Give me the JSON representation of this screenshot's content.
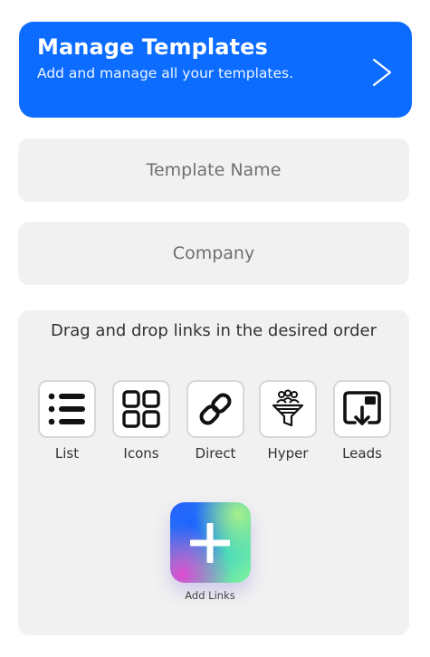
{
  "header": {
    "title": "Manage Templates",
    "subtitle": "Add and manage all your templates.",
    "arrow_icon": "chevron-right-icon",
    "background": "#0b6cff"
  },
  "fields": {
    "template_name": {
      "placeholder": "Template Name",
      "value": ""
    },
    "company": {
      "placeholder": "Company",
      "value": ""
    }
  },
  "links_panel": {
    "instruction": "Drag and drop links in the desired order",
    "link_types": [
      {
        "label": "List",
        "icon": "list-icon"
      },
      {
        "label": "Icons",
        "icon": "grid-icon"
      },
      {
        "label": "Direct",
        "icon": "chain-link-icon"
      },
      {
        "label": "Hyper",
        "icon": "funnel-people-icon"
      },
      {
        "label": "Leads",
        "icon": "screen-download-icon"
      }
    ],
    "add_links": {
      "label": "Add Links",
      "icon": "plus-icon"
    }
  }
}
